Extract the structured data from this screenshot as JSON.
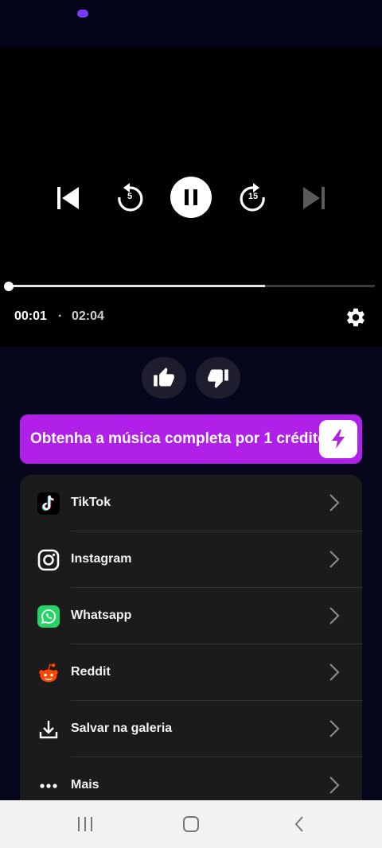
{
  "status": {
    "indicator": "status-dot"
  },
  "player": {
    "current_time": "00:01",
    "separator": "·",
    "total_time": "02:04",
    "progress": 0.7,
    "rewind_seconds": "5",
    "forward_seconds": "15",
    "state": "playing"
  },
  "cta": {
    "label": "Obtenha a música completa por 1 crédito"
  },
  "share": {
    "items": [
      {
        "label": "TikTok",
        "icon": "tiktok-icon"
      },
      {
        "label": "Instagram",
        "icon": "instagram-icon"
      },
      {
        "label": "Whatsapp",
        "icon": "whatsapp-icon"
      },
      {
        "label": "Reddit",
        "icon": "reddit-icon"
      },
      {
        "label": "Salvar na galeria",
        "icon": "download-icon"
      },
      {
        "label": "Mais",
        "icon": "more-icon"
      }
    ]
  },
  "colors": {
    "accent": "#b020e8",
    "background": "#06061c",
    "panel": "#1b1b1b",
    "whatsapp": "#25d366",
    "reddit": "#ff4500"
  }
}
